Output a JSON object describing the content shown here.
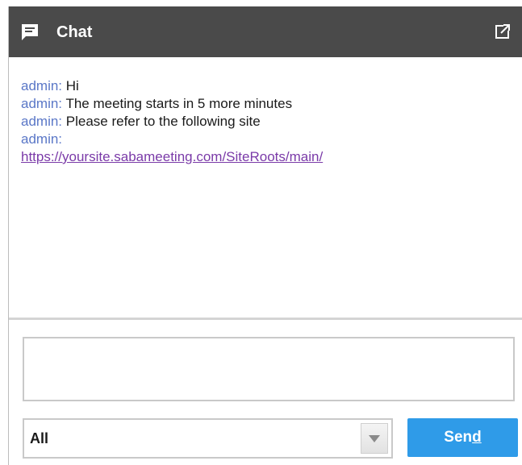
{
  "header": {
    "title": "Chat",
    "icon": "chat-bubble-icon",
    "popout_icon": "popout-icon"
  },
  "messages": [
    {
      "sender": "admin:",
      "text": " Hi",
      "link": ""
    },
    {
      "sender": "admin:",
      "text": " The meeting starts in 5 more minutes",
      "link": ""
    },
    {
      "sender": "admin:",
      "text": " Please refer to the following site",
      "link": ""
    },
    {
      "sender": "admin:",
      "text": "",
      "link": "https://yoursite.sabameeting.com/SiteRoots/main/"
    }
  ],
  "composer": {
    "input_value": "",
    "recipient_selected": "All",
    "send_label_prefix": "Sen",
    "send_label_accesskey": "d"
  },
  "colors": {
    "titlebar": "#4a4a4a",
    "sender": "#5a77c7",
    "link": "#7a3aa8",
    "send_button": "#2f9be8"
  }
}
